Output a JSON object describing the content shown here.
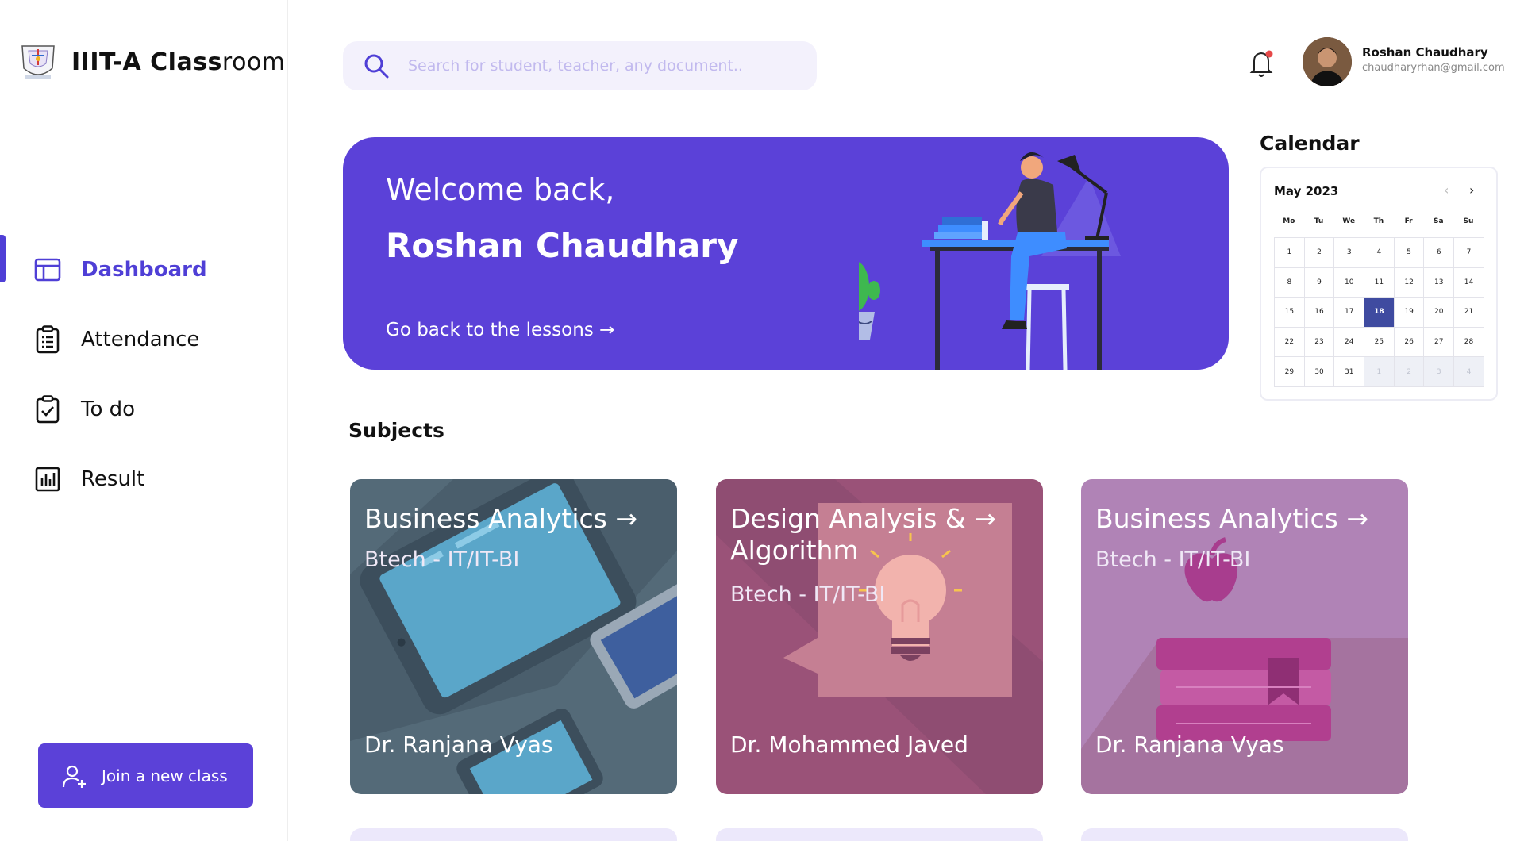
{
  "brand": {
    "bold": "IIIT-A Class",
    "light": "room",
    "logo_icon": "iiita-emblem-icon"
  },
  "nav": {
    "items": [
      {
        "label": "Dashboard",
        "icon": "layout-icon",
        "active": true
      },
      {
        "label": "Attendance",
        "icon": "clipboard-list-icon",
        "active": false
      },
      {
        "label": "To do",
        "icon": "clipboard-check-icon",
        "active": false
      },
      {
        "label": "Result",
        "icon": "bar-chart-icon",
        "active": false
      }
    ],
    "active_color": "#4f3fd6"
  },
  "join": {
    "label": "Join a new class",
    "icon": "user-plus-icon",
    "color": "#5b41d8"
  },
  "search": {
    "placeholder": "Search for student, teacher, any document..",
    "value": ""
  },
  "user": {
    "name": "Roshan Chaudhary",
    "email": "chaudharyrhan@gmail.com",
    "has_notification": true
  },
  "banner": {
    "greeting": "Welcome back,",
    "name": "Roshan Chaudhary",
    "link": "Go back to the lessons →",
    "color": "#5b41d8"
  },
  "calendar": {
    "title": "Calendar",
    "month": "May 2023",
    "prev": "‹",
    "next": "›",
    "weekdays": [
      "Mo",
      "Tu",
      "We",
      "Th",
      "Fr",
      "Sa",
      "Su"
    ],
    "days": [
      "1",
      "2",
      "3",
      "4",
      "5",
      "6",
      "7",
      "8",
      "9",
      "10",
      "11",
      "12",
      "13",
      "14",
      "15",
      "16",
      "17",
      "18",
      "19",
      "20",
      "21",
      "22",
      "23",
      "24",
      "25",
      "26",
      "27",
      "28",
      "29",
      "30",
      "31",
      "1",
      "2",
      "3",
      "4"
    ],
    "today": "18",
    "trailing_other_month": 4
  },
  "subjects": {
    "title": "Subjects",
    "cards": [
      {
        "title": "Business Analytics →",
        "subtitle": "Btech - IT/IT-BI",
        "teacher": "Dr. Ranjana Vyas",
        "bg": "#546a78"
      },
      {
        "title": "Design Analysis & → Algorithm",
        "subtitle": "Btech - IT/IT-BI",
        "teacher": "Dr. Mohammed Javed",
        "bg": "#9a5278"
      },
      {
        "title": "Business Analytics →",
        "subtitle": "Btech - IT/IT-BI",
        "teacher": "Dr. Ranjana Vyas",
        "bg": "#b083b6"
      }
    ]
  }
}
